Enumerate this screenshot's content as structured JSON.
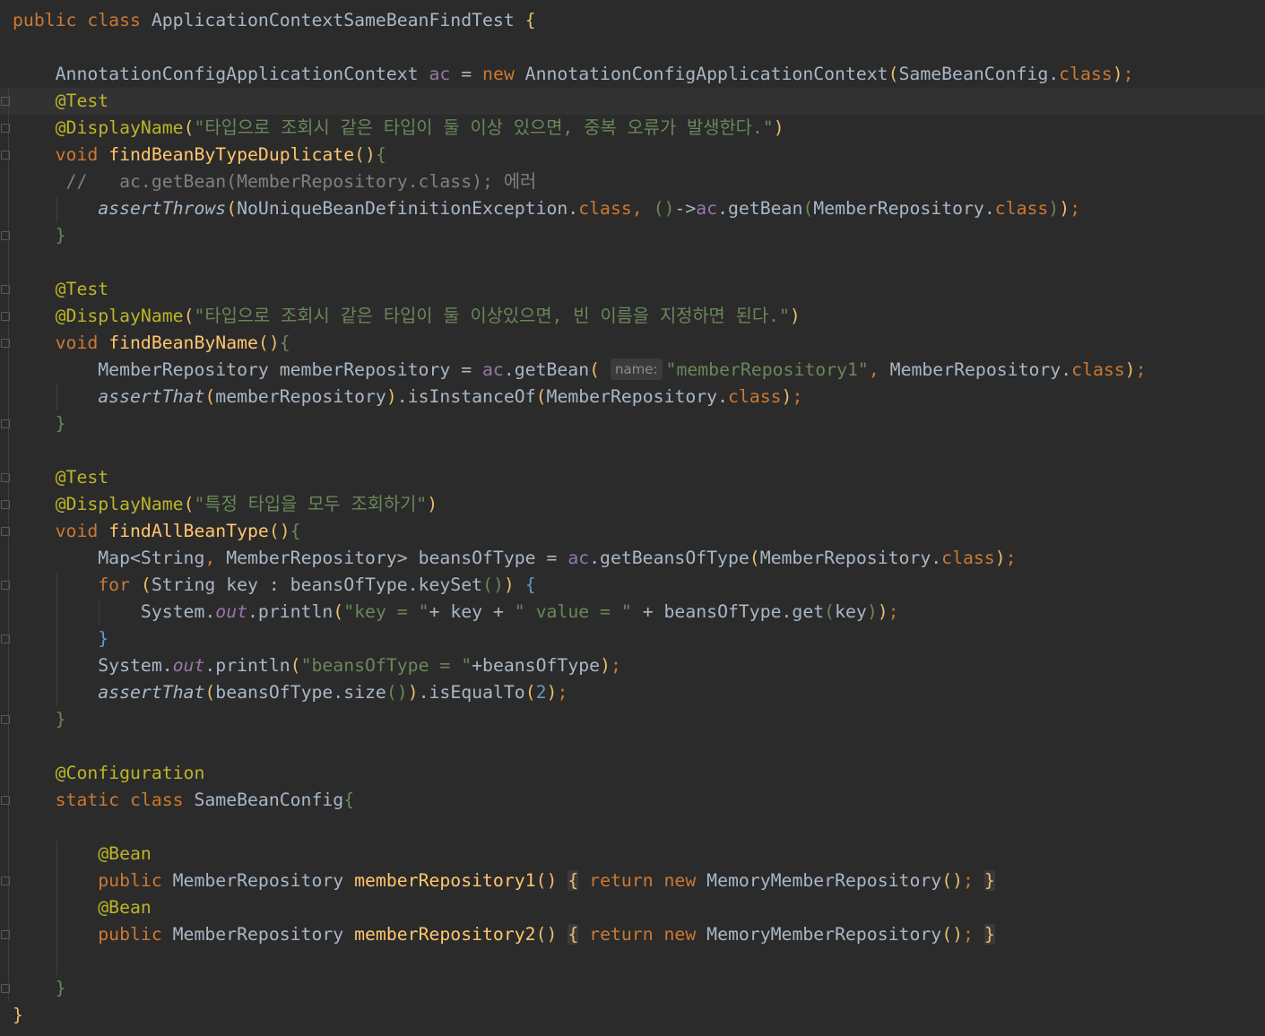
{
  "editor": {
    "lines": [
      [
        [
          "kw",
          "public class "
        ],
        [
          "t",
          "ApplicationContextSameBeanFindTest "
        ],
        [
          "b1",
          "{"
        ]
      ],
      [],
      [
        [
          "t",
          "    AnnotationConfigApplicationContext "
        ],
        [
          "fld",
          "ac"
        ],
        [
          "t",
          " = "
        ],
        [
          "kw",
          "new "
        ],
        [
          "t",
          "AnnotationConfigApplicationContext"
        ],
        [
          "b1",
          "("
        ],
        [
          "t",
          "SameBeanConfig."
        ],
        [
          "kw",
          "class"
        ],
        [
          "b1",
          ")"
        ],
        [
          "kw",
          ";"
        ]
      ],
      [
        [
          "ann",
          "    @Test"
        ]
      ],
      [
        [
          "ann",
          "    @DisplayName"
        ],
        [
          "b1",
          "("
        ],
        [
          "str",
          "\"타입으로 조회시 같은 타입이 둘 이상 있으면, 중복 오류가 발생한다.\""
        ],
        [
          "b1",
          ")"
        ]
      ],
      [
        [
          "kw",
          "    void "
        ],
        [
          "meth",
          "findBeanByTypeDuplicate"
        ],
        [
          "b1",
          "()"
        ],
        [
          "b2",
          "{"
        ]
      ],
      [
        [
          "cmt",
          "     //   ac.getBean(MemberRepository.class); 에러"
        ]
      ],
      [
        [
          "stat",
          "        assertThrows"
        ],
        [
          "b1",
          "("
        ],
        [
          "t",
          "NoUniqueBeanDefinitionException."
        ],
        [
          "kw",
          "class, "
        ],
        [
          "b2",
          "()"
        ],
        [
          "t",
          "->"
        ],
        [
          "fld",
          "ac"
        ],
        [
          "t",
          ".getBean"
        ],
        [
          "b2",
          "("
        ],
        [
          "t",
          "MemberRepository."
        ],
        [
          "kw",
          "class"
        ],
        [
          "b2",
          ")"
        ],
        [
          "b1",
          ")"
        ],
        [
          "kw",
          ";"
        ]
      ],
      [
        [
          "b2",
          "    }"
        ]
      ],
      [],
      [
        [
          "ann",
          "    @Test"
        ]
      ],
      [
        [
          "ann",
          "    @DisplayName"
        ],
        [
          "b1",
          "("
        ],
        [
          "str",
          "\"타입으로 조회시 같은 타입이 둘 이상있으면, 빈 이름을 지정하면 된다.\""
        ],
        [
          "b1",
          ")"
        ]
      ],
      [
        [
          "kw",
          "    void "
        ],
        [
          "meth",
          "findBeanByName"
        ],
        [
          "b1",
          "()"
        ],
        [
          "b2",
          "{"
        ]
      ],
      [
        [
          "t",
          "        MemberRepository memberRepository = "
        ],
        [
          "fld",
          "ac"
        ],
        [
          "t",
          ".getBean"
        ],
        [
          "b1",
          "( "
        ],
        [
          "hint",
          "name:"
        ],
        [
          "str",
          "\"memberRepository1\""
        ],
        [
          "kw",
          ", "
        ],
        [
          "t",
          "MemberRepository."
        ],
        [
          "kw",
          "class"
        ],
        [
          "b1",
          ")"
        ],
        [
          "kw",
          ";"
        ]
      ],
      [
        [
          "stat",
          "        assertThat"
        ],
        [
          "b1",
          "("
        ],
        [
          "t",
          "memberRepository"
        ],
        [
          "b1",
          ")"
        ],
        [
          "t",
          ".isInstanceOf"
        ],
        [
          "b1",
          "("
        ],
        [
          "t",
          "MemberRepository."
        ],
        [
          "kw",
          "class"
        ],
        [
          "b1",
          ")"
        ],
        [
          "kw",
          ";"
        ]
      ],
      [
        [
          "b2",
          "    }"
        ]
      ],
      [],
      [
        [
          "ann",
          "    @Test"
        ]
      ],
      [
        [
          "ann",
          "    @DisplayName"
        ],
        [
          "b1",
          "("
        ],
        [
          "str",
          "\"특정 타입을 모두 조회하기\""
        ],
        [
          "b1",
          ")"
        ]
      ],
      [
        [
          "kw",
          "    void "
        ],
        [
          "meth",
          "findAllBeanType"
        ],
        [
          "b1",
          "()"
        ],
        [
          "b2",
          "{"
        ]
      ],
      [
        [
          "t",
          "        Map<String"
        ],
        [
          "kw",
          ", "
        ],
        [
          "t",
          "MemberRepository> beansOfType = "
        ],
        [
          "fld",
          "ac"
        ],
        [
          "t",
          ".getBeansOfType"
        ],
        [
          "b1",
          "("
        ],
        [
          "t",
          "MemberRepository."
        ],
        [
          "kw",
          "class"
        ],
        [
          "b1",
          ")"
        ],
        [
          "kw",
          ";"
        ]
      ],
      [
        [
          "kw",
          "        for "
        ],
        [
          "b1",
          "("
        ],
        [
          "t",
          "String key : beansOfType.keySet"
        ],
        [
          "b2",
          "()"
        ],
        [
          "b1",
          ") "
        ],
        [
          "b3",
          "{"
        ]
      ],
      [
        [
          "t",
          "            System."
        ],
        [
          "sfld",
          "out"
        ],
        [
          "t",
          ".println"
        ],
        [
          "b1",
          "("
        ],
        [
          "str",
          "\"key = \""
        ],
        [
          "t",
          "+ key + "
        ],
        [
          "str",
          "\" value = \""
        ],
        [
          "t",
          " + beansOfType.get"
        ],
        [
          "b2",
          "("
        ],
        [
          "t",
          "key"
        ],
        [
          "b2",
          ")"
        ],
        [
          "b1",
          ")"
        ],
        [
          "kw",
          ";"
        ]
      ],
      [
        [
          "b3",
          "        }"
        ]
      ],
      [
        [
          "t",
          "        System."
        ],
        [
          "sfld",
          "out"
        ],
        [
          "t",
          ".println"
        ],
        [
          "b1",
          "("
        ],
        [
          "str",
          "\"beansOfType = \""
        ],
        [
          "t",
          "+beansOfType"
        ],
        [
          "b1",
          ")"
        ],
        [
          "kw",
          ";"
        ]
      ],
      [
        [
          "stat",
          "        assertThat"
        ],
        [
          "b1",
          "("
        ],
        [
          "t",
          "beansOfType.size"
        ],
        [
          "b2",
          "()"
        ],
        [
          "b1",
          ")"
        ],
        [
          "t",
          ".isEqualTo"
        ],
        [
          "b1",
          "("
        ],
        [
          "num",
          "2"
        ],
        [
          "b1",
          ")"
        ],
        [
          "kw",
          ";"
        ]
      ],
      [
        [
          "b2",
          "    }"
        ]
      ],
      [],
      [
        [
          "ann",
          "    @Configuration"
        ]
      ],
      [
        [
          "kw",
          "    static class "
        ],
        [
          "t",
          "SameBeanConfig"
        ],
        [
          "b2",
          "{"
        ]
      ],
      [],
      [
        [
          "ann",
          "        @Bean"
        ]
      ],
      [
        [
          "kw",
          "        public "
        ],
        [
          "t",
          "MemberRepository "
        ],
        [
          "meth",
          "memberRepository1"
        ],
        [
          "b1",
          "()"
        ],
        [
          "t",
          " "
        ],
        [
          "fold",
          "{"
        ],
        [
          "kw",
          " return new "
        ],
        [
          "t",
          "MemoryMemberRepository"
        ],
        [
          "b1",
          "()"
        ],
        [
          "kw",
          ";"
        ],
        [
          "t",
          " "
        ],
        [
          "fold",
          "}"
        ]
      ],
      [
        [
          "ann",
          "        @Bean"
        ]
      ],
      [
        [
          "kw",
          "        public "
        ],
        [
          "t",
          "MemberRepository "
        ],
        [
          "meth",
          "memberRepository2"
        ],
        [
          "b1",
          "()"
        ],
        [
          "t",
          " "
        ],
        [
          "fold",
          "{"
        ],
        [
          "kw",
          " return new "
        ],
        [
          "t",
          "MemoryMemberRepository"
        ],
        [
          "b1",
          "()"
        ],
        [
          "kw",
          ";"
        ],
        [
          "t",
          " "
        ],
        [
          "fold",
          "}"
        ]
      ],
      [],
      [
        [
          "b2",
          "    }"
        ]
      ],
      [
        [
          "b1",
          "}"
        ]
      ]
    ],
    "current_line": 3
  },
  "icons": {
    "intention_bulb": "lightbulb-icon",
    "fold_marker": "fold-marker-icon"
  },
  "colors": {
    "background": "#2b2b2b",
    "keyword": "#cc7832",
    "annotation": "#bbb529",
    "string": "#6a8759",
    "field": "#9876aa",
    "method": "#ffc66d",
    "text": "#a9b7c6",
    "comment": "#808080",
    "bulb": "#f0c43c"
  }
}
